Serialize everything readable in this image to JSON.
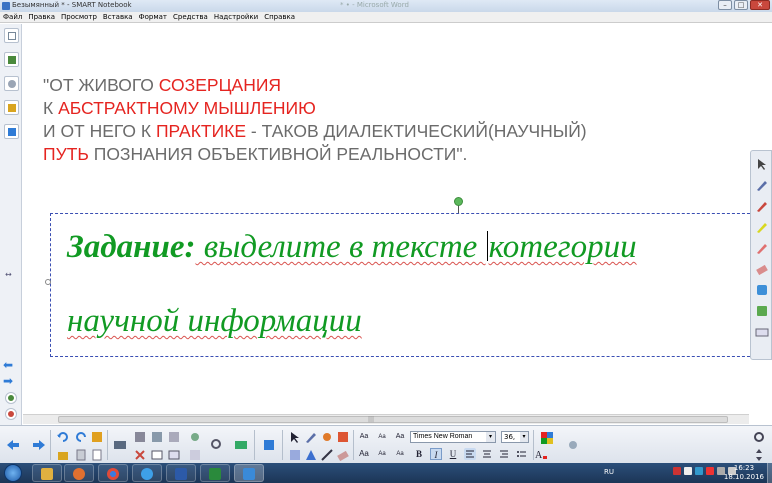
{
  "window": {
    "title": "Безымянный * - SMART Notebook",
    "ghost_title": "* • - Microsoft Word",
    "min_label": "–",
    "max_label": "□",
    "close_label": "✕"
  },
  "menu": [
    "Файл",
    "Правка",
    "Просмотр",
    "Вставка",
    "Формат",
    "Средства",
    "Надстройки",
    "Справка"
  ],
  "quote": {
    "line1_a": "\"ОТ ЖИВОГО ",
    "line1_b": "СОЗЕРЦАНИЯ",
    "line2_a": "К  ",
    "line2_b": "АБСТРАКТНОМУ  МЫШЛЕНИЮ",
    "line3_a": "И ОТ НЕГО К   ",
    "line3_b": "ПРАКТИКЕ",
    "line3_c": " - ТАКОВ ДИАЛЕКТИЧЕСКИЙ(НАУЧНЫЙ)",
    "line4_a": " ПУТЬ",
    "line4_b": " ПОЗНАНИЯ ОБЪЕКТИВНОЙ РЕАЛЬНОСТИ\"."
  },
  "task": {
    "label": "Задание:",
    "text1_a": " выделите в тексте ",
    "text1_b": "котегории",
    "text2": "научной информации"
  },
  "format_toolbar": {
    "font_name": "Times New Roman",
    "font_size": "36,",
    "dropdown_arrow": "▾",
    "aa_small": "Aa",
    "bold": "B",
    "italic": "I",
    "underline": "U"
  },
  "left_toolbar": {
    "collapse": "↔"
  },
  "right_palette": {
    "collapse": "⋮⋮"
  },
  "scrollbar": {
    "grip": "|||"
  },
  "taskbar": {
    "lang": "RU",
    "time": "16:23",
    "date": "18.10.2016"
  },
  "colors": {
    "accent_red": "#e52420",
    "task_green": "#119a23",
    "text_gray": "#6b6b6b"
  }
}
